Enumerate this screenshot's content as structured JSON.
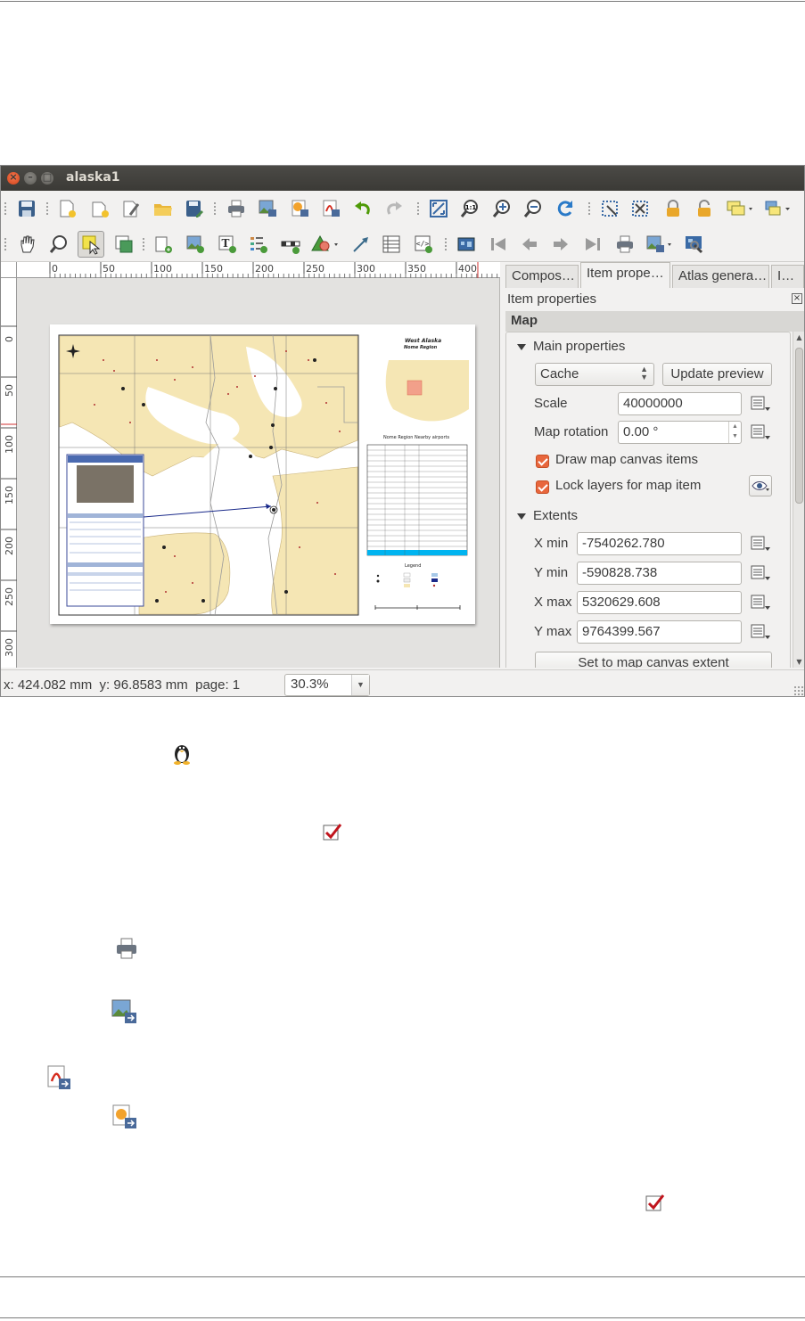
{
  "window": {
    "title": "alaska1"
  },
  "toolbar1": {
    "icons": [
      "save-icon",
      "new-composer-icon",
      "duplicate-composer-icon",
      "composer-manager-icon",
      "open-template-icon",
      "save-as-template-icon",
      "print-icon",
      "export-image-icon",
      "export-svg-icon",
      "export-pdf-icon",
      "undo-icon",
      "redo-icon",
      "zoom-full-icon",
      "zoom-actual-icon",
      "zoom-in-icon",
      "zoom-out-icon",
      "refresh-icon",
      "select-all-icon",
      "deselect-icon",
      "lock-icon",
      "unlock-icon",
      "group-icon",
      "raise-icon"
    ]
  },
  "toolbar2": {
    "icons": [
      "pan-icon",
      "zoom-tool-icon",
      "select-move-icon",
      "move-content-icon",
      "add-map-icon",
      "add-image-icon",
      "add-label-icon",
      "add-legend-icon",
      "add-scalebar-icon",
      "add-shape-icon",
      "add-arrow-icon",
      "add-table-icon",
      "add-html-icon",
      "atlas-preview-icon",
      "first-feature-icon",
      "previous-feature-icon",
      "next-feature-icon",
      "last-feature-icon",
      "print-atlas-icon",
      "export-atlas-icon",
      "atlas-settings-icon"
    ]
  },
  "ruler": {
    "top_labels": [
      "0",
      "50",
      "100",
      "150",
      "200",
      "250",
      "300",
      "350",
      "400"
    ],
    "left_labels": [
      "0",
      "50",
      "100",
      "150",
      "200",
      "250",
      "300"
    ]
  },
  "map_preview": {
    "title": "West Alaska",
    "subtitle": "Nome Region",
    "table_title": "Nome Region Nearby airports",
    "legend_title": "Legend",
    "popup_title": "Unalakleet Airport"
  },
  "dock": {
    "tabs": [
      "Compos…",
      "Item prope…",
      "Atlas genera…",
      "I…"
    ],
    "title": "Item properties",
    "close": "×",
    "section": "Map",
    "main_properties": {
      "header": "Main properties",
      "cache_option": "Cache",
      "update_preview": "Update preview",
      "scale_label": "Scale",
      "scale_value": "40000000",
      "rotation_label": "Map rotation",
      "rotation_value": "0.00 °",
      "draw_items_label": "Draw map canvas items",
      "draw_items_checked": true,
      "lock_layers_label": "Lock layers for map item",
      "lock_layers_checked": true
    },
    "extents": {
      "header": "Extents",
      "xmin_label": "X min",
      "xmin_value": "-7540262.780",
      "ymin_label": "Y min",
      "ymin_value": "-590828.738",
      "xmax_label": "X max",
      "xmax_value": "5320629.608",
      "ymax_label": "Y max",
      "ymax_value": "9764399.567",
      "set_extent_button": "Set to map canvas extent"
    }
  },
  "statusbar": {
    "coords": "x: 424.082 mm  y: 96.8583 mm  page: 1",
    "zoom": "30.3%"
  },
  "colors": {
    "titlebar": "#3c3b37",
    "accent_checkbox": "#e8663c",
    "map_land": "#f5e6b4",
    "table_highlight": "#00b4f0"
  }
}
